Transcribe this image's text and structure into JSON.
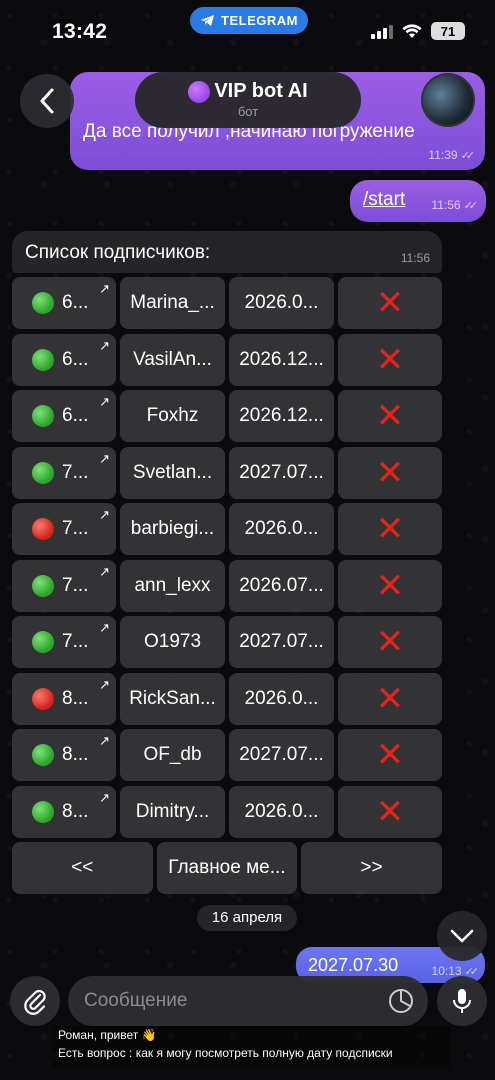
{
  "status_bar": {
    "time": "13:42",
    "app_pill": "TELEGRAM",
    "battery": "71"
  },
  "header": {
    "title": "VIP bot AI",
    "subtitle": "бот"
  },
  "messages": {
    "first": {
      "text": "Да все получил ,начинаю погружение",
      "time": "11:39"
    },
    "start": {
      "text": "/start",
      "time": "11:56"
    },
    "list": {
      "text": "Список подписчиков:",
      "time": "11:56"
    },
    "date_chip": "16 апреля",
    "last": {
      "text": "2027.07.30",
      "time": "10:13"
    }
  },
  "subscribers": [
    {
      "id": "6...",
      "status": "green",
      "name": "Marina_...",
      "date": "2026.0..."
    },
    {
      "id": "6...",
      "status": "green",
      "name": "VasilAn...",
      "date": "2026.12..."
    },
    {
      "id": "6...",
      "status": "green",
      "name": "Foxhz",
      "date": "2026.12..."
    },
    {
      "id": "7...",
      "status": "green",
      "name": "Svetlan...",
      "date": "2027.07..."
    },
    {
      "id": "7...",
      "status": "red",
      "name": "barbiegi...",
      "date": "2026.0..."
    },
    {
      "id": "7...",
      "status": "green",
      "name": "ann_lexx",
      "date": "2026.07..."
    },
    {
      "id": "7...",
      "status": "green",
      "name": "O1973",
      "date": "2027.07..."
    },
    {
      "id": "8...",
      "status": "red",
      "name": "RickSan...",
      "date": "2026.0..."
    },
    {
      "id": "8...",
      "status": "green",
      "name": "OF_db",
      "date": "2027.07..."
    },
    {
      "id": "8...",
      "status": "green",
      "name": "Dimitry...",
      "date": "2026.0..."
    }
  ],
  "nav": {
    "prev": "<<",
    "main_menu": "Главное ме...",
    "next": ">>"
  },
  "input": {
    "placeholder": "Сообщение"
  },
  "notification": {
    "line1": "Роман, привет 👋",
    "line2": "Есть вопрос : как я могу посмотреть полную дату подсписки"
  },
  "icons": {
    "back": "chevron-left-icon",
    "attach": "paperclip-icon",
    "sticker": "sticker-icon",
    "mic": "microphone-icon",
    "scroll": "chevron-down-icon",
    "delete": "cross-icon"
  },
  "colors": {
    "outgoing_bubble": "#8a55df",
    "last_bubble": "#5f68ea",
    "status_green": "#2ca52a",
    "status_red": "#d2241a",
    "telegram_blue": "#2a7be6"
  }
}
